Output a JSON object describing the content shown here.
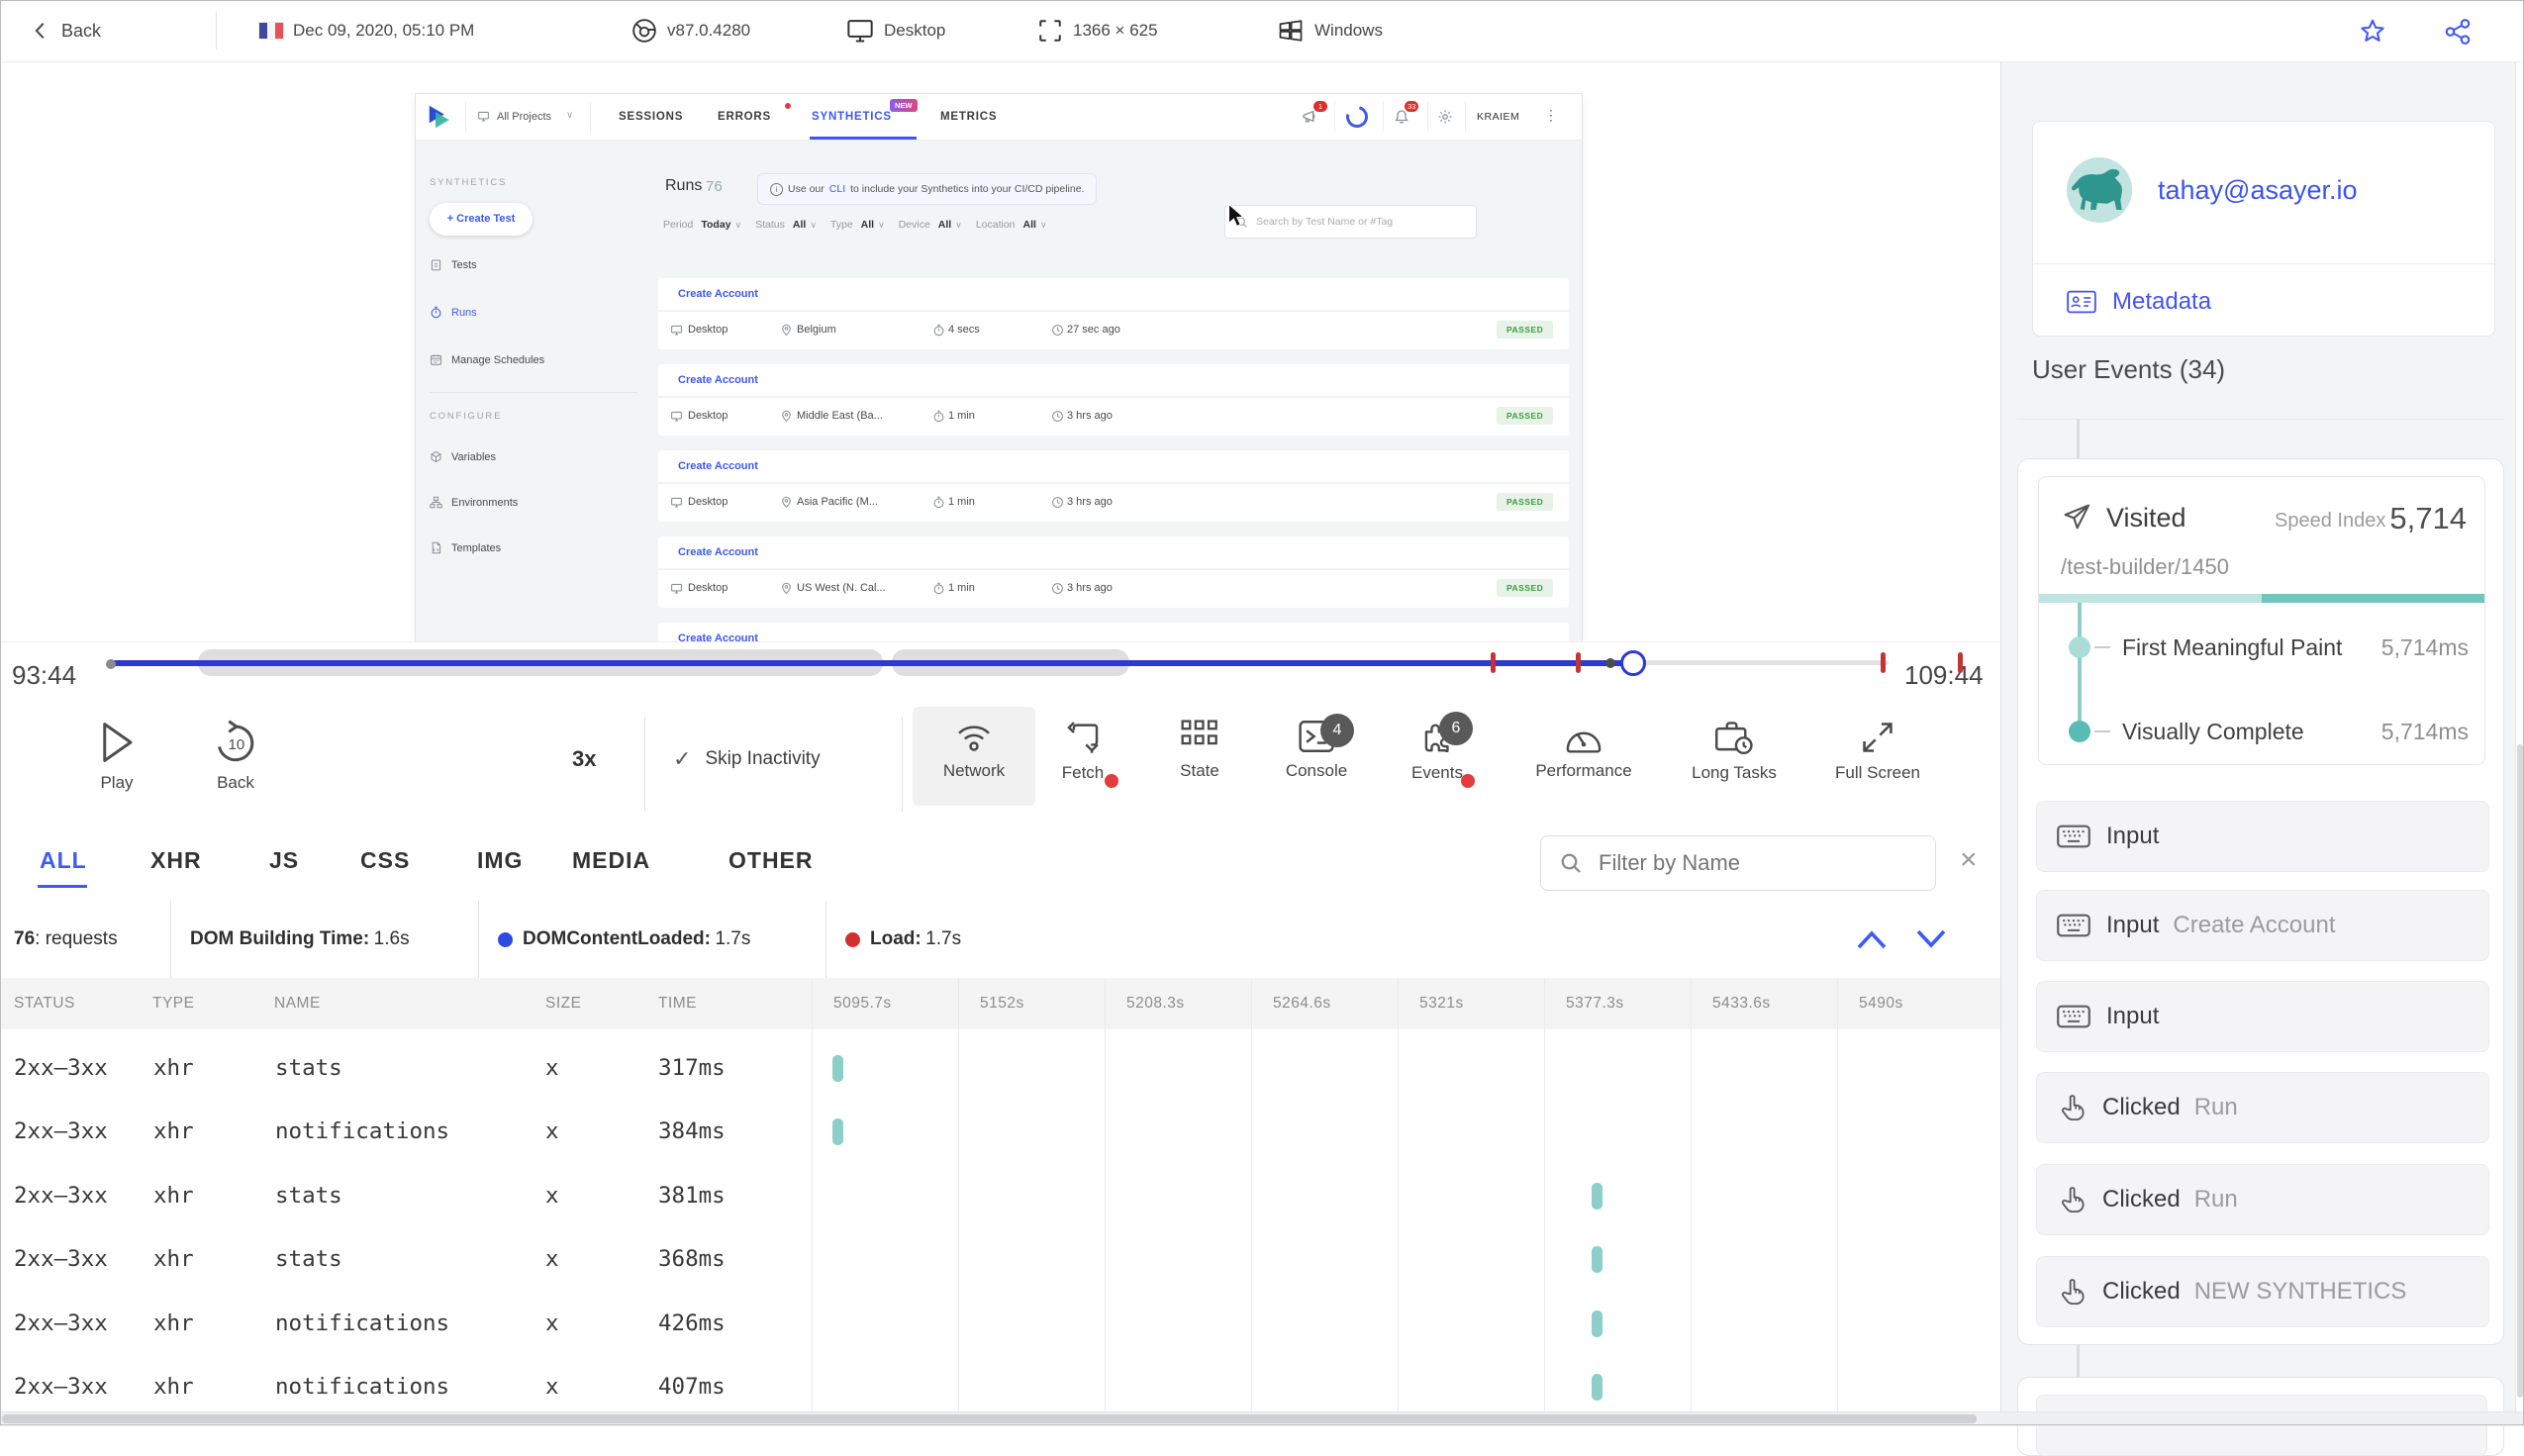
{
  "icons": {
    "back_chevron": "‹",
    "dropdown_chevron": "∨",
    "check": "✓",
    "kebab": "⋮",
    "close": "×",
    "info": "i",
    "resolution_sep": "×"
  },
  "topbar": {
    "back": "Back",
    "date": "Dec 09, 2020, 05:10 PM",
    "browser_version": "v87.0.4280",
    "device": "Desktop",
    "resolution": "1366 × 625",
    "os": "Windows"
  },
  "app": {
    "project_selector": "All Projects",
    "tabs": {
      "sessions": "SESSIONS",
      "errors": "ERRORS",
      "synthetics": "SYNTHETICS",
      "synthetics_badge": "NEW",
      "metrics": "METRICS"
    },
    "header_right": {
      "megaphone_badge": "1",
      "bell_badge": "33",
      "user": "KRAIEM"
    },
    "sidebar": {
      "section": "SYNTHETICS",
      "create_test": "+ Create Test",
      "tests": "Tests",
      "runs": "Runs",
      "manage_schedules": "Manage Schedules",
      "configure": "CONFIGURE",
      "variables": "Variables",
      "environments": "Environments",
      "templates": "Templates"
    },
    "main": {
      "title": "Runs",
      "count": "76",
      "banner_prefix": "Use our ",
      "banner_link": "CLI",
      "banner_suffix": " to include your Synthetics into your CI/CD pipeline.",
      "filters": [
        {
          "label": "Period",
          "value": "Today"
        },
        {
          "label": "Status",
          "value": "All"
        },
        {
          "label": "Type",
          "value": "All"
        },
        {
          "label": "Device",
          "value": "All"
        },
        {
          "label": "Location",
          "value": "All"
        }
      ],
      "search_placeholder": "Search by Test Name or #Tag",
      "runs": [
        {
          "name": "Create Account",
          "device": "Desktop",
          "location": "Belgium",
          "duration": "4 secs",
          "ago": "27 sec ago",
          "status": "PASSED"
        },
        {
          "name": "Create Account",
          "device": "Desktop",
          "location": "Middle East (Ba...",
          "duration": "1 min",
          "ago": "3 hrs ago",
          "status": "PASSED"
        },
        {
          "name": "Create Account",
          "device": "Desktop",
          "location": "Asia Pacific (M...",
          "duration": "1 min",
          "ago": "3 hrs ago",
          "status": "PASSED"
        },
        {
          "name": "Create Account",
          "device": "Desktop",
          "location": "US West (N. Cal...",
          "duration": "1 min",
          "ago": "3 hrs ago",
          "status": "PASSED"
        },
        {
          "name": "Create Account"
        }
      ]
    }
  },
  "timeline": {
    "start": "93:44",
    "end": "109:44"
  },
  "controls": {
    "play": "Play",
    "back": "Back",
    "back_amount": "10",
    "speed": "3x",
    "skip_inactivity": "Skip Inactivity",
    "network": "Network",
    "fetch": "Fetch",
    "state": "State",
    "console": "Console",
    "console_badge": "4",
    "events": "Events",
    "events_badge": "6",
    "performance": "Performance",
    "long_tasks": "Long Tasks",
    "full_screen": "Full Screen"
  },
  "network": {
    "tabs": [
      "ALL",
      "XHR",
      "JS",
      "CSS",
      "IMG",
      "MEDIA",
      "OTHER"
    ],
    "filter_placeholder": "Filter by Name",
    "stats": {
      "requests_count": "76",
      "requests_label": ": requests",
      "dom_label": "DOM Building Time:",
      "dom_value": "1.6s",
      "dcl_label": "DOMContentLoaded:",
      "dcl_value": "1.7s",
      "load_label": "Load:",
      "load_value": "1.7s"
    },
    "table": {
      "headers": {
        "status": "STATUS",
        "type": "TYPE",
        "name": "NAME",
        "size": "SIZE",
        "time": "TIME"
      },
      "time_columns": [
        "5095.7s",
        "5152s",
        "5208.3s",
        "5264.6s",
        "5321s",
        "5377.3s",
        "5433.6s",
        "5490s"
      ],
      "rows": [
        {
          "status": "2xx–3xx",
          "type": "xhr",
          "name": "stats",
          "size": "x",
          "time": "317ms"
        },
        {
          "status": "2xx–3xx",
          "type": "xhr",
          "name": "notifications",
          "size": "x",
          "time": "384ms"
        },
        {
          "status": "2xx–3xx",
          "type": "xhr",
          "name": "stats",
          "size": "x",
          "time": "381ms"
        },
        {
          "status": "2xx–3xx",
          "type": "xhr",
          "name": "stats",
          "size": "x",
          "time": "368ms"
        },
        {
          "status": "2xx–3xx",
          "type": "xhr",
          "name": "notifications",
          "size": "x",
          "time": "426ms"
        },
        {
          "status": "2xx–3xx",
          "type": "xhr",
          "name": "notifications",
          "size": "x",
          "time": "407ms"
        }
      ]
    }
  },
  "sidebar": {
    "email": "tahay@asayer.io",
    "metadata": "Metadata",
    "events_title": "User Events (34)",
    "visited": {
      "label": "Visited",
      "speed_index_label": "Speed Index",
      "speed_index": "5,714",
      "url": "/test-builder/1450",
      "metrics": [
        {
          "name": "First Meaningful Paint",
          "value": "5,714ms"
        },
        {
          "name": "Visually Complete",
          "value": "5,714ms"
        }
      ]
    },
    "events": [
      {
        "type": "Input",
        "target": ""
      },
      {
        "type": "Input",
        "target": "Create Account"
      },
      {
        "type": "Input",
        "target": ""
      },
      {
        "type": "Clicked",
        "target": "Run"
      },
      {
        "type": "Clicked",
        "target": "Run"
      },
      {
        "type": "Clicked",
        "target": "NEW SYNTHETICS"
      }
    ]
  },
  "colors": {
    "accent_blue": "#3b5af7",
    "progress_blue": "#2c3ad0",
    "teal": "#59bcb4",
    "teal_light": "#abdcd8",
    "red_marker": "#c43434",
    "green_passed": "#3e9b44"
  }
}
